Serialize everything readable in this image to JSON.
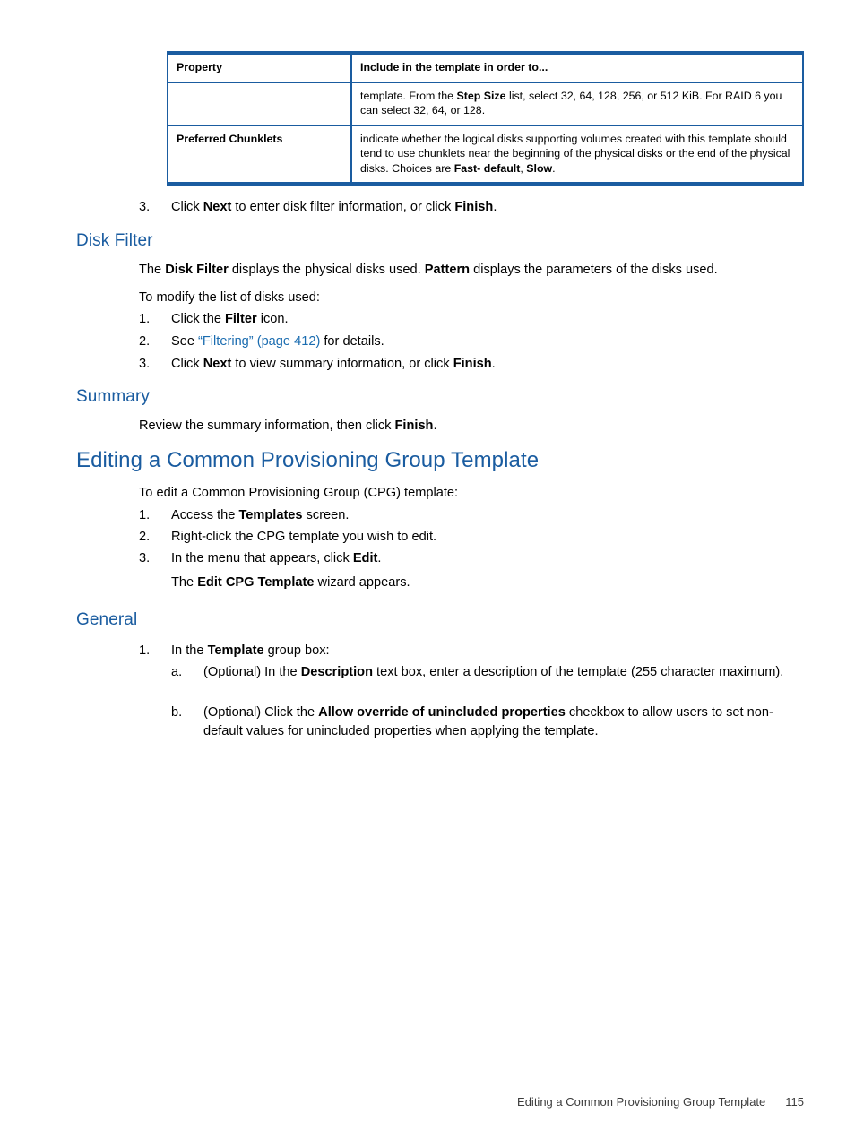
{
  "table": {
    "headers": [
      "Property",
      "Include in the template in order to..."
    ],
    "rows": [
      {
        "property": "",
        "description_parts": [
          {
            "t": "template. From the ",
            "b": false
          },
          {
            "t": "Step Size",
            "b": true
          },
          {
            "t": " list, select 32, 64, 128, 256, or 512 KiB. For RAID 6 you can select 32, 64, or 128.",
            "b": false
          }
        ]
      },
      {
        "property": "Preferred Chunklets",
        "description_parts": [
          {
            "t": "indicate whether the logical disks supporting volumes created with this template should tend to use chunklets near the beginning of the physical disks or the end of the physical disks. Choices are ",
            "b": false
          },
          {
            "t": "Fast- default",
            "b": true
          },
          {
            "t": ", ",
            "b": false
          },
          {
            "t": "Slow",
            "b": true
          },
          {
            "t": ".",
            "b": false
          }
        ]
      }
    ]
  },
  "step3_top": {
    "marker": "3.",
    "text_html": "Click <b>Next</b> to enter disk filter information, or click <b>Finish</b>."
  },
  "disk_filter": {
    "heading": "Disk Filter",
    "intro_html": "The <b>Disk Filter</b> displays the physical disks used. <b>Pattern</b> displays the parameters of the disks used.",
    "lead_in": "To modify the list of disks used:",
    "steps": [
      {
        "marker": "1.",
        "text_html": "Click the <b>Filter</b> icon."
      },
      {
        "marker": "2.",
        "text_html": "See <a class=\"lnk\" href=\"#\" data-name=\"filtering-cross-reference-link\" data-interactable=\"true\">“Filtering” (page 412)</a> for details."
      },
      {
        "marker": "3.",
        "text_html": "Click <b>Next</b> to view summary information, or click <b>Finish</b>."
      }
    ]
  },
  "summary": {
    "heading": "Summary",
    "text_html": "Review the summary information, then click <b>Finish</b>."
  },
  "editing_cpg": {
    "heading": "Editing a Common Provisioning Group Template",
    "intro": "To edit a Common Provisioning Group (CPG) template:",
    "steps": [
      {
        "marker": "1.",
        "text_html": "Access the <b>Templates</b> screen."
      },
      {
        "marker": "2.",
        "text_html": "Right-click the CPG template you wish to edit."
      },
      {
        "marker": "3.",
        "text_html": "In the menu that appears, click <b>Edit</b>."
      }
    ],
    "result_html": "The <b>Edit CPG Template</b> wizard appears."
  },
  "general": {
    "heading": "General",
    "step1": {
      "marker": "1.",
      "text_html": "In the <b>Template</b> group box:"
    },
    "substeps": [
      {
        "marker": "a.",
        "text_html": "(Optional) In the <b>Description</b> text box, enter a description of the template (255 character maximum)."
      },
      {
        "marker": "b.",
        "text_html": "(Optional) Click the <b>Allow override of unincluded properties</b> checkbox to allow users to set non-default values for unincluded properties when applying the template."
      }
    ]
  },
  "footer": {
    "chapter": "Editing a Common Provisioning Group Template",
    "page_number": "115"
  },
  "colors": {
    "heading_blue": "#1a5ca0",
    "link_blue": "#1a6cb0",
    "table_border": "#1a5ca0",
    "body_text": "#000000",
    "footer_text": "#3b3b3b"
  }
}
